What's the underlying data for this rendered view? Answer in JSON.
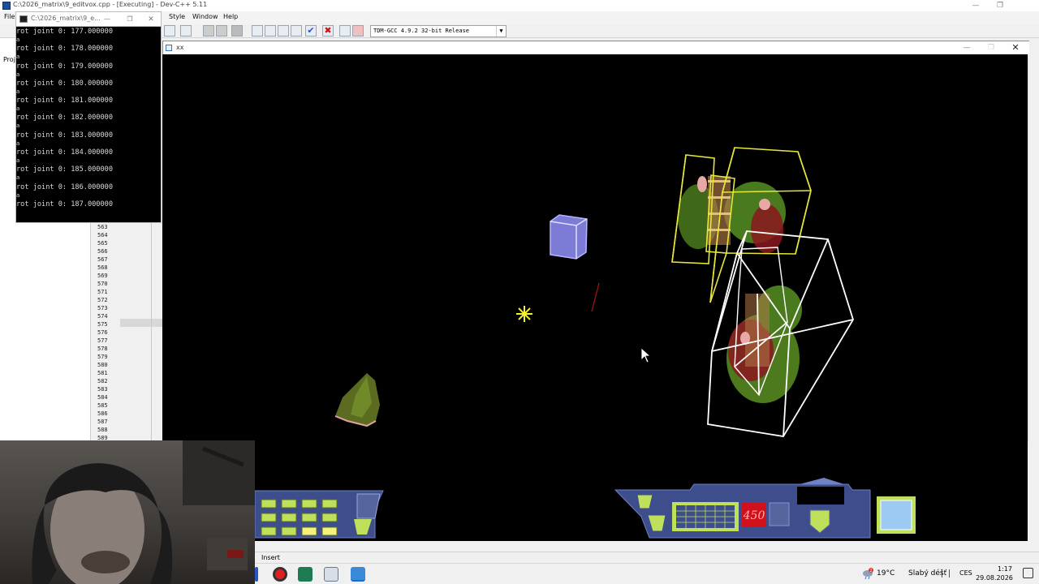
{
  "devcpp": {
    "title": "C:\\2026_matrix\\9_editvox.cpp - [Executing] - Dev-C++ 5.11",
    "menu": [
      "File",
      "Style",
      "Window",
      "Help"
    ],
    "compiler": "TDM-GCC 4.9.2 32-bit Release",
    "project_tab": "Proj",
    "gutter_lines": [
      "563",
      "564",
      "565",
      "566",
      "567",
      "568",
      "569",
      "570",
      "571",
      "572",
      "573",
      "574",
      "575",
      "576",
      "577",
      "578",
      "579",
      "580",
      "581",
      "582",
      "583",
      "584",
      "585",
      "586",
      "587",
      "588",
      "589"
    ],
    "status_mode": "Insert"
  },
  "console": {
    "title": "C:\\2026_matrix\\9_e...",
    "lines": [
      {
        "rot": "rot joint 0: 177.000000",
        "key": "a"
      },
      {
        "rot": "rot joint 0: 178.000000",
        "key": "a"
      },
      {
        "rot": "rot joint 0: 179.000000",
        "key": "a"
      },
      {
        "rot": "rot joint 0: 180.000000",
        "key": "a"
      },
      {
        "rot": "rot joint 0: 181.000000",
        "key": "a"
      },
      {
        "rot": "rot joint 0: 182.000000",
        "key": "a"
      },
      {
        "rot": "rot joint 0: 183.000000",
        "key": "a"
      },
      {
        "rot": "rot joint 0: 184.000000",
        "key": "a"
      },
      {
        "rot": "rot joint 0: 185.000000",
        "key": "a"
      },
      {
        "rot": "rot joint 0: 186.000000",
        "key": "a"
      },
      {
        "rot": "rot joint 0: 187.000000",
        "key": ""
      }
    ]
  },
  "game": {
    "title": "xx",
    "hud_counter": "450"
  },
  "taskbar": {
    "weather_temp": "19°C",
    "weather_desc": "Slabý déšť",
    "language": "CES",
    "time": "1:17",
    "date": "29.08.2026",
    "weather_badge": "2"
  },
  "colors": {
    "selection_yellow": "#e8e83a",
    "selection_white": "#ffffff",
    "cube_blue": "#8c8ce6",
    "hud_panel": "#3e4d8c",
    "hud_lime": "#bfe05a",
    "hud_red": "#d0101a"
  }
}
